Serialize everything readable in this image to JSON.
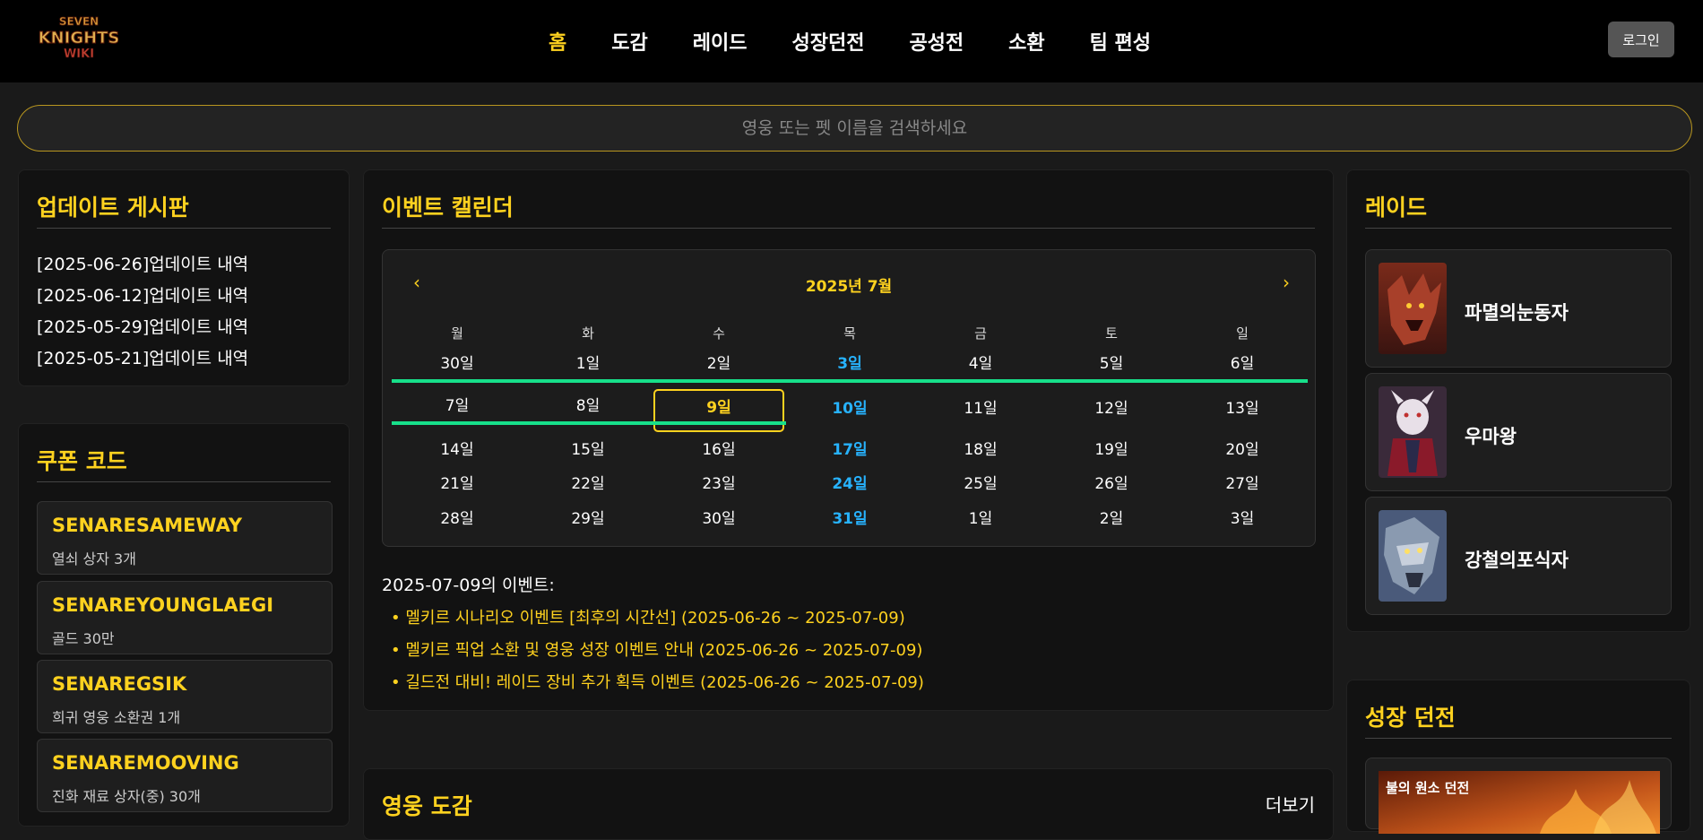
{
  "header": {
    "logo_text": "SEVEN KNIGHTS WIKI",
    "nav": [
      "홈",
      "도감",
      "레이드",
      "성장던전",
      "공성전",
      "소환",
      "팀 편성"
    ],
    "active_nav": 0,
    "login_label": "로그인"
  },
  "search": {
    "placeholder": "영웅 또는 펫 이름을 검색하세요"
  },
  "updates": {
    "title": "업데이트 게시판",
    "items": [
      "[2025-06-26]업데이트 내역",
      "[2025-06-12]업데이트 내역",
      "[2025-05-29]업데이트 내역",
      "[2025-05-21]업데이트 내역"
    ]
  },
  "coupons": {
    "title": "쿠폰 코드",
    "items": [
      {
        "code": "SENARESAMEWAY",
        "reward": "열쇠 상자 3개"
      },
      {
        "code": "SENAREYOUNGLAEGI",
        "reward": "골드 30만"
      },
      {
        "code": "SENAREGSIK",
        "reward": "희귀 영웅 소환권 1개"
      },
      {
        "code": "SENAREMOOVING",
        "reward": "진화 재료 상자(중) 30개"
      }
    ]
  },
  "calendar": {
    "title": "이벤트 캘린더",
    "month_label": "2025년 7월",
    "prev": "‹",
    "next": "›",
    "weekdays": [
      "월",
      "화",
      "수",
      "목",
      "금",
      "토",
      "일"
    ],
    "weeks": [
      [
        "30일",
        "1일",
        "2일",
        "3일",
        "4일",
        "5일",
        "6일"
      ],
      [
        "7일",
        "8일",
        "9일",
        "10일",
        "11일",
        "12일",
        "13일"
      ],
      [
        "14일",
        "15일",
        "16일",
        "17일",
        "18일",
        "19일",
        "20일"
      ],
      [
        "21일",
        "22일",
        "23일",
        "24일",
        "25일",
        "26일",
        "27일"
      ],
      [
        "28일",
        "29일",
        "30일",
        "31일",
        "1일",
        "2일",
        "3일"
      ]
    ],
    "selected": "9일",
    "event_color": "#17e08a",
    "selected_date_label": "2025-07-09의 이벤트:",
    "events": [
      "• 멜키르 시나리오 이벤트 [최후의 시간선] (2025-06-26 ~ 2025-07-09)",
      "• 멜키르 픽업 소환 및 영웅 성장 이벤트 안내 (2025-06-26 ~ 2025-07-09)",
      "• 길드전 대비! 레이드 장비 추가 획득 이벤트 (2025-06-26 ~ 2025-07-09)"
    ]
  },
  "heroes": {
    "title": "영웅 도감",
    "more_label": "더보기"
  },
  "raid": {
    "title": "레이드",
    "items": [
      "파멸의눈동자",
      "우마왕",
      "강철의포식자"
    ]
  },
  "growth": {
    "title": "성장 던전",
    "first_item": "불의 원소 던전"
  },
  "colors": {
    "accent": "#ffd21f",
    "thursday": "#27b3ff",
    "event_bar": "#17e08a"
  }
}
